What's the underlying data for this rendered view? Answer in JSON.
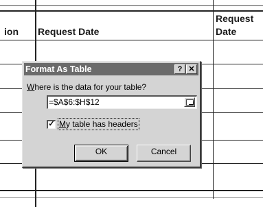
{
  "spreadsheet": {
    "headers": [
      "ion",
      "Request Date",
      "Request",
      "Date"
    ]
  },
  "dialog": {
    "title": "Format As Table",
    "help_button": "?",
    "close_button": "✕",
    "prompt_label": "Where is the data for your table?",
    "range_value": "=$A$6:$H$12",
    "collapse_icon": "range-collapse-icon",
    "has_headers_checked": true,
    "has_headers_label": "My table has headers",
    "ok_label": "OK",
    "cancel_label": "Cancel"
  }
}
